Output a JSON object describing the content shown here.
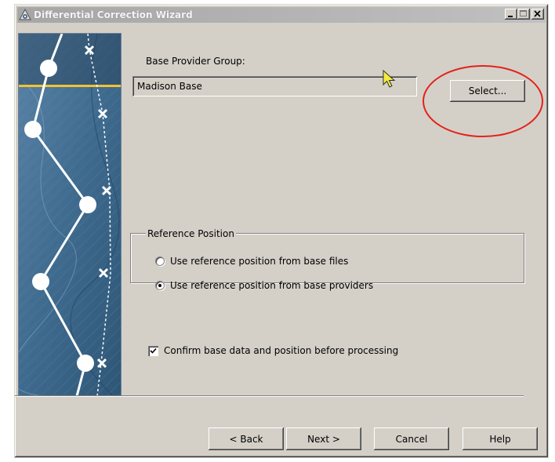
{
  "window": {
    "title": "Differential Correction Wizard",
    "controls": [
      "minimize-icon",
      "maximize-icon",
      "close-icon"
    ]
  },
  "base_provider": {
    "label": "Base Provider Group:",
    "value": "Madison Base",
    "select_label": "Select..."
  },
  "reference_position": {
    "legend": "Reference Position",
    "options": [
      {
        "label": "Use reference position from base files",
        "selected": false
      },
      {
        "label": "Use reference position from base providers",
        "selected": true
      }
    ]
  },
  "confirm": {
    "label": "Confirm base data and position before processing",
    "checked": true
  },
  "footer": {
    "back_label": "< Back",
    "next_label": "Next >",
    "cancel_label": "Cancel",
    "help_label": "Help"
  },
  "colors": {
    "face": "#d4d0c8",
    "annotation_circle": "#e2231a",
    "art_blue": "#3f6b8f",
    "art_highlight": "#f2c230"
  }
}
